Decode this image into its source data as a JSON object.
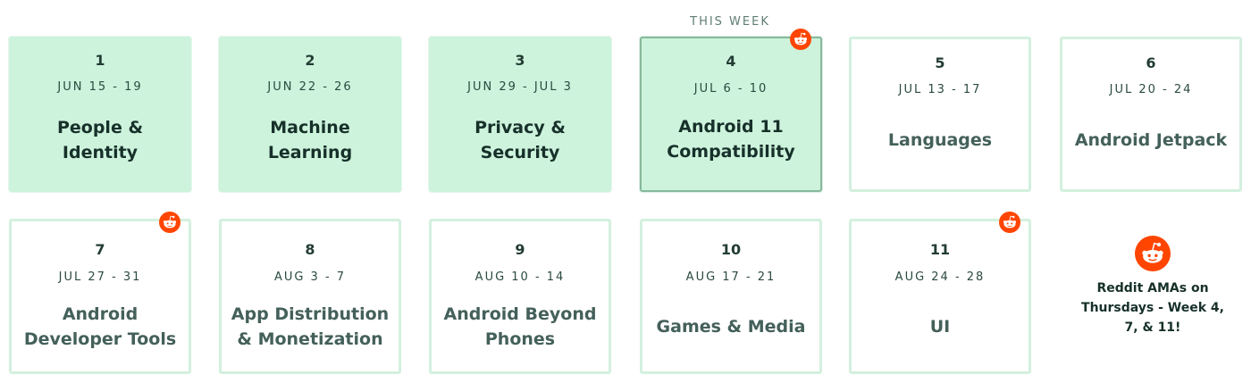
{
  "header": {
    "this_week_label": "THIS WEEK"
  },
  "weeks": [
    {
      "num": "1",
      "dates": "JUN 15 - 19",
      "topic": "People & Identity"
    },
    {
      "num": "2",
      "dates": "JUN 22 - 26",
      "topic": "Machine Learning"
    },
    {
      "num": "3",
      "dates": "JUN 29 - JUL 3",
      "topic": "Privacy & Security"
    },
    {
      "num": "4",
      "dates": "JUL 6 - 10",
      "topic": "Android 11 Compatibility"
    },
    {
      "num": "5",
      "dates": "JUL 13 - 17",
      "topic": "Languages"
    },
    {
      "num": "6",
      "dates": "JUL 20 - 24",
      "topic": "Android Jetpack"
    },
    {
      "num": "7",
      "dates": "JUL 27 - 31",
      "topic": "Android Developer Tools"
    },
    {
      "num": "8",
      "dates": "AUG 3 - 7",
      "topic": "App Distribution & Monetization"
    },
    {
      "num": "9",
      "dates": "AUG 10 - 14",
      "topic": "Android Beyond Phones"
    },
    {
      "num": "10",
      "dates": "AUG 17 - 21",
      "topic": "Games & Media"
    },
    {
      "num": "11",
      "dates": "AUG 24 - 28",
      "topic": "UI"
    }
  ],
  "ama": {
    "text": "Reddit AMAs on Thursdays - Week 4, 7, & 11!"
  },
  "colors": {
    "past_card_bg": "#cdf3dc",
    "current_card_border": "#87b99b",
    "future_card_border": "#d3f0de",
    "reddit_orange": "#ff4500"
  },
  "icons": {
    "reddit": "reddit-icon"
  }
}
